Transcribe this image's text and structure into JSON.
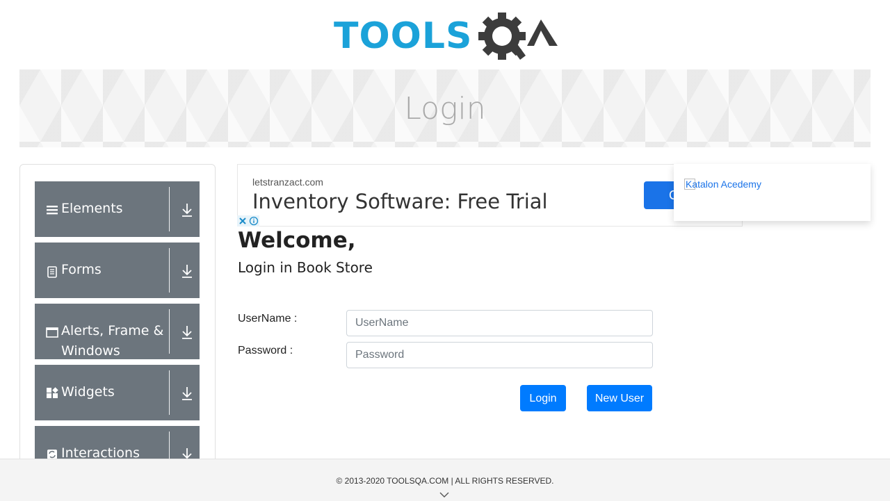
{
  "header": {
    "logo_text_left": "TOOLS",
    "logo_text_right": "QA",
    "page_title": "Login"
  },
  "sidebar": {
    "groups": [
      {
        "label": "Elements",
        "icon": "hamburger-icon"
      },
      {
        "label": "Forms",
        "icon": "document-icon"
      },
      {
        "label": "Alerts, Frame & Windows",
        "icon": "window-icon"
      },
      {
        "label": "Widgets",
        "icon": "widgets-icon"
      },
      {
        "label": "Interactions",
        "icon": "interactions-icon"
      }
    ]
  },
  "ad": {
    "domain": "letstranzact.com",
    "title": "Inventory Software: Free Trial",
    "button_label": "C"
  },
  "katalon": {
    "alt_text": "Katalon Acedemy"
  },
  "form": {
    "welcome": "Welcome,",
    "subtitle": "Login in Book Store",
    "username_label": "UserName :",
    "username_placeholder": "UserName",
    "password_label": "Password :",
    "password_placeholder": "Password",
    "login_button": "Login",
    "new_user_button": "New User"
  },
  "footer": {
    "copyright": "© 2013-2020 TOOLSQA.COM | ALL RIGHTS RESERVED."
  },
  "colors": {
    "brand_blue": "#1ba2d9",
    "brand_dark": "#3c3c3c",
    "sidebar_bg": "#6c757d",
    "primary_button": "#007bff"
  }
}
